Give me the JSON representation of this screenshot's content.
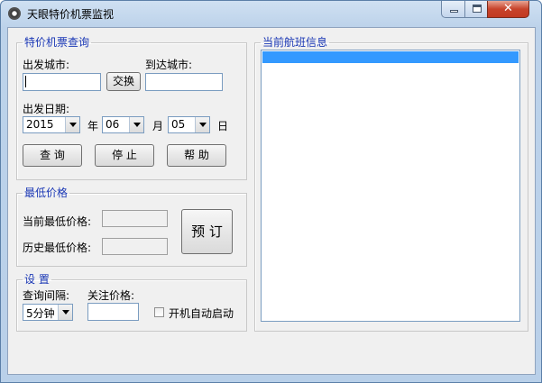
{
  "window": {
    "title": "天眼特价机票监视",
    "min_label": "",
    "max_label": "",
    "close_label": "✕"
  },
  "query_group": {
    "legend": "特价机票查询",
    "depart_city_label": "出发城市:",
    "arrive_city_label": "到达城市:",
    "depart_city_value": "",
    "arrive_city_value": "",
    "swap_button": "交换",
    "date_label": "出发日期:",
    "year": "2015",
    "year_unit": "年",
    "month": "06",
    "month_unit": "月",
    "day": "05",
    "day_unit": "日",
    "query_button": "查 询",
    "stop_button": "停 止",
    "help_button": "帮 助"
  },
  "lowest_group": {
    "legend": "最低价格",
    "current_label": "当前最低价格:",
    "history_label": "历史最低价格:",
    "current_value": "",
    "history_value": "",
    "book_button": "预 订"
  },
  "settings_group": {
    "legend": "设 置",
    "interval_label": "查询间隔:",
    "watch_price_label": "关注价格:",
    "interval_value": "5分钟",
    "watch_price_value": "",
    "autostart_label": "开机自动启动",
    "autostart_checked": false
  },
  "flight_group": {
    "legend": "当前航班信息"
  }
}
